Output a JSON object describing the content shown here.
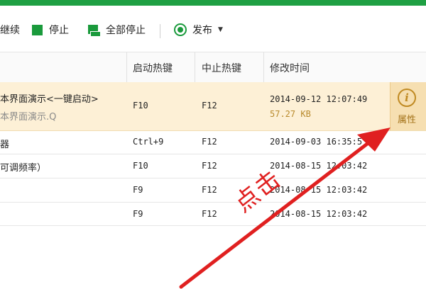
{
  "toolbar": {
    "continue_label": "继续",
    "stop_label": "停止",
    "stop_all_label": "全部停止",
    "publish_label": "发布"
  },
  "table": {
    "headers": {
      "start_hotkey": "启动热键",
      "stop_hotkey": "中止热键",
      "modified": "修改时间"
    },
    "rows": [
      {
        "name": "本界面演示<一键启动>",
        "subname": "本界面演示.Q",
        "start": "F10",
        "stop": "F12",
        "modified": "2014-09-12 12:07:49",
        "size": "57.27 KB"
      },
      {
        "name": "器",
        "start": "Ctrl+9",
        "stop": "F12",
        "modified": "2014-09-03 16:35:5"
      },
      {
        "name": "可调频率）",
        "start": "F10",
        "stop": "F12",
        "modified": "2014-08-15 12:03:42"
      },
      {
        "name": "",
        "start": "F9",
        "stop": "F12",
        "modified": "2014-08-15 12:03:42"
      },
      {
        "name": "",
        "start": "F9",
        "stop": "F12",
        "modified": "2014-08-15 12:03:42"
      }
    ]
  },
  "properties_button": {
    "label": "属性",
    "icon": "info-icon"
  },
  "annotation": {
    "text": "点击",
    "color": "#e02020"
  },
  "colors": {
    "brand": "#1fa043",
    "selected_row": "#fdf0d6",
    "accent": "#e02020"
  }
}
